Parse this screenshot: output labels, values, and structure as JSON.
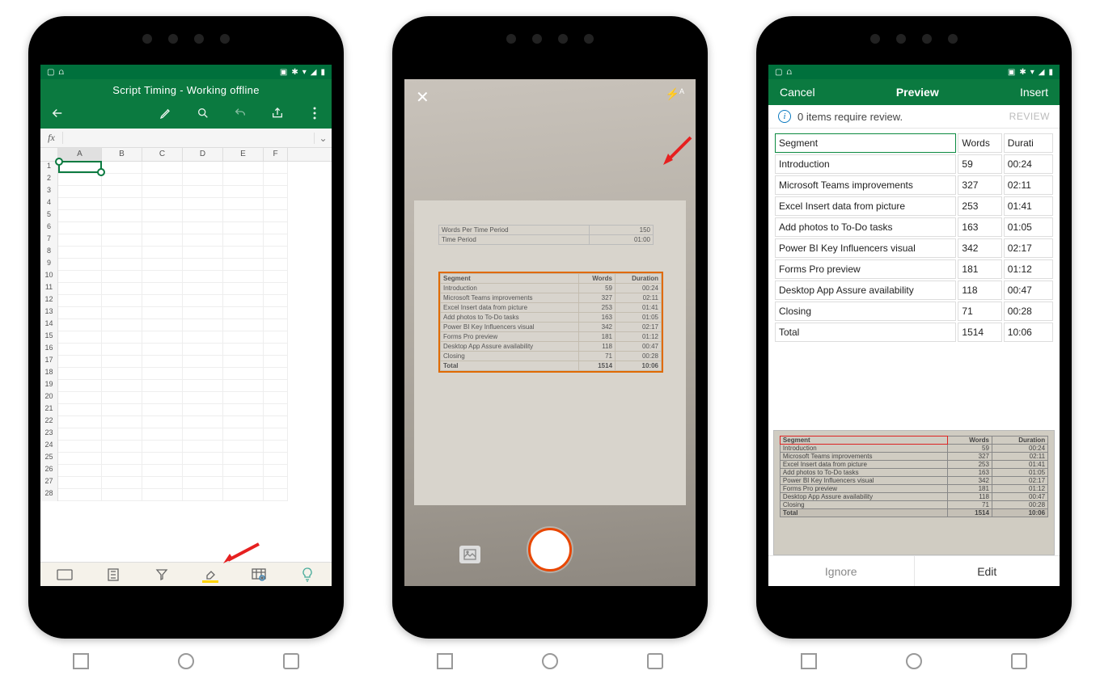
{
  "phone1": {
    "title": "Script Timing - Working offline",
    "columns": [
      "A",
      "B",
      "C",
      "D",
      "E",
      "F"
    ],
    "row_count": 28,
    "toolbar_icons": [
      "pen",
      "search",
      "undo",
      "share",
      "more"
    ],
    "bottom_icons": [
      "keyboard",
      "sort",
      "filter",
      "fill",
      "insert-data-from-picture",
      "ideas"
    ],
    "fx_label": "fx"
  },
  "phone2": {
    "flash_mode": "A",
    "mini_rows": [
      [
        "Words Per Time Period",
        "150"
      ],
      [
        "Time Period",
        "01:00"
      ]
    ],
    "captured": {
      "headers": [
        "Segment",
        "Words",
        "Duration"
      ],
      "rows": [
        [
          "Introduction",
          "59",
          "00:24"
        ],
        [
          "Microsoft Teams improvements",
          "327",
          "02:11"
        ],
        [
          "Excel Insert data from picture",
          "253",
          "01:41"
        ],
        [
          "Add photos to To-Do tasks",
          "163",
          "01:05"
        ],
        [
          "Power BI Key Influencers visual",
          "342",
          "02:17"
        ],
        [
          "Forms Pro preview",
          "181",
          "01:12"
        ],
        [
          "Desktop App Assure availability",
          "118",
          "00:47"
        ],
        [
          "Closing",
          "71",
          "00:28"
        ],
        [
          "Total",
          "1514",
          "10:06"
        ]
      ]
    }
  },
  "phone3": {
    "cancel": "Cancel",
    "title": "Preview",
    "insert": "Insert",
    "review_msg": "0 items require review.",
    "review_btn": "REVIEW",
    "headers": [
      "Segment",
      "Words",
      "Durati"
    ],
    "rows": [
      [
        "Segment",
        "Words",
        "Durati"
      ],
      [
        "Introduction",
        "59",
        "00:24"
      ],
      [
        "Microsoft Teams improvements",
        "327",
        "02:11"
      ],
      [
        "Excel Insert data from picture",
        "253",
        "01:41"
      ],
      [
        "Add photos to To-Do tasks",
        "163",
        "01:05"
      ],
      [
        "Power BI Key Influencers visual",
        "342",
        "02:17"
      ],
      [
        "Forms Pro preview",
        "181",
        "01:12"
      ],
      [
        "Desktop App Assure availability",
        "118",
        "00:47"
      ],
      [
        "Closing",
        "71",
        "00:28"
      ],
      [
        "Total",
        "1514",
        "10:06"
      ]
    ],
    "thumb_headers": [
      "Segment",
      "Words",
      "Duration"
    ],
    "thumb_rows": [
      [
        "Introduction",
        "59",
        "00:24"
      ],
      [
        "Microsoft Teams improvements",
        "327",
        "02:11"
      ],
      [
        "Excel Insert data from picture",
        "253",
        "01:41"
      ],
      [
        "Add photos to To-Do tasks",
        "163",
        "01:05"
      ],
      [
        "Power BI Key Influencers visual",
        "342",
        "02:17"
      ],
      [
        "Forms Pro preview",
        "181",
        "01:12"
      ],
      [
        "Desktop App Assure availability",
        "118",
        "00:47"
      ],
      [
        "Closing",
        "71",
        "00:28"
      ],
      [
        "Total",
        "1514",
        "10:06"
      ]
    ],
    "ignore": "Ignore",
    "edit": "Edit"
  }
}
